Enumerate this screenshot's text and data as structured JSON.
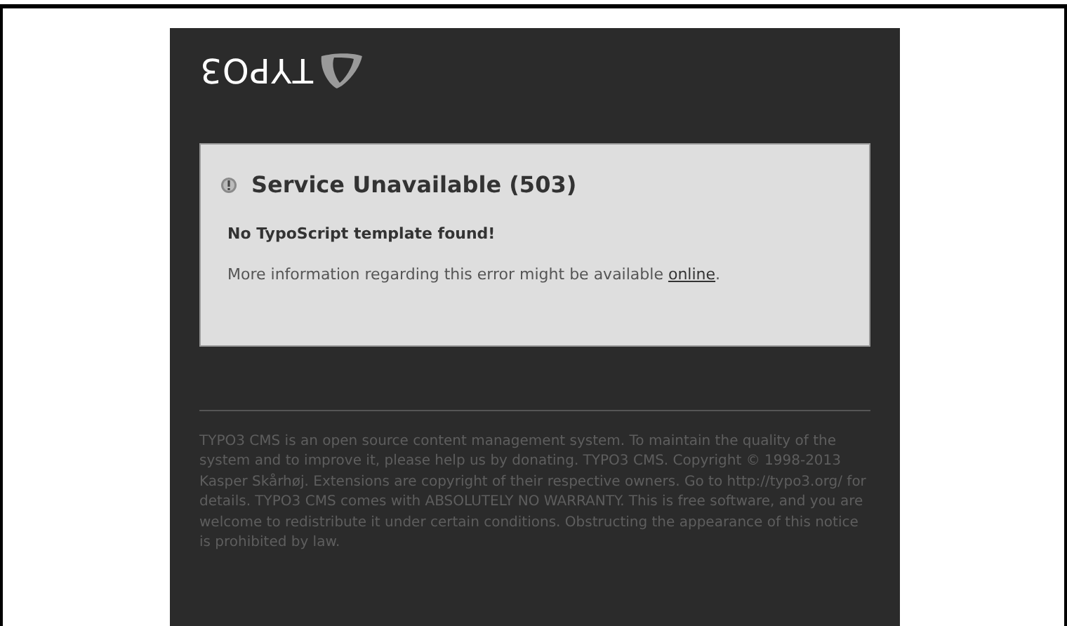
{
  "logo": {
    "text": "TYPO3"
  },
  "error": {
    "title": "Service Unavailable (503)",
    "message": "No TypoScript template found!",
    "info": "More information regarding this error might be available",
    "link": "online",
    "after_link": "."
  },
  "footer": "TYPO3 CMS is an open source content management system. To maintain the quality of the system and to improve it, please help us by donating. TYPO3 CMS. Copyright © 1998-2013 Kasper Skårhøj. Extensions are copyright of their respective owners. Go to http://typo3.org/ for details. TYPO3 CMS comes with ABSOLUTELY NO WARRANTY. This is free software, and you are welcome to redistribute it under certain conditions. Obstructing the appearance of this notice is prohibited by law."
}
